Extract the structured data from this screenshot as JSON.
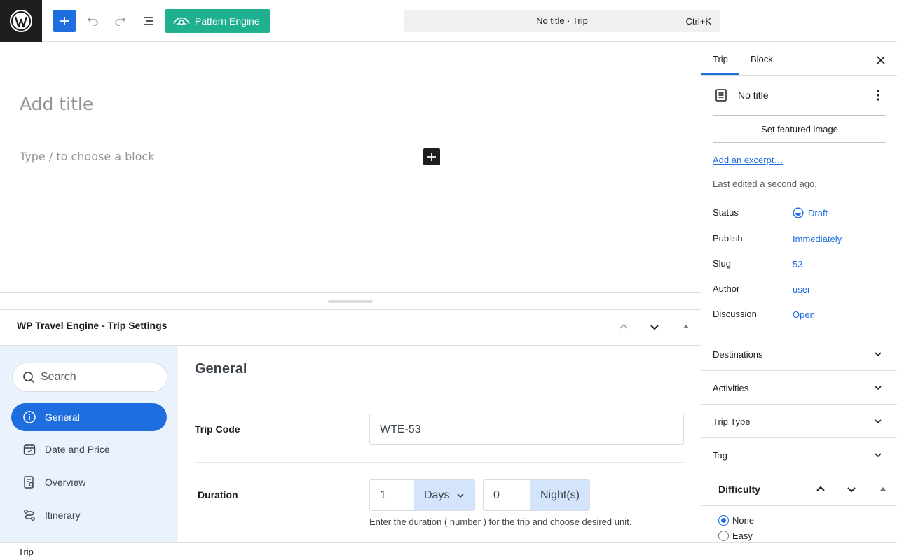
{
  "topbar": {
    "pattern_engine_label": "Pattern Engine",
    "command_title": "No title · Trip",
    "command_shortcut": "Ctrl+K"
  },
  "editor": {
    "title_placeholder": "Add title",
    "block_placeholder": "Type / to choose a block"
  },
  "meta_box": {
    "title": "WP Travel Engine - Trip Settings",
    "search_placeholder": "Search",
    "nav_items": [
      {
        "label": "General",
        "icon": "info-icon"
      },
      {
        "label": "Date and Price",
        "icon": "calendar-icon"
      },
      {
        "label": "Overview",
        "icon": "overview-icon"
      },
      {
        "label": "Itinerary",
        "icon": "route-icon"
      }
    ],
    "section_title": "General",
    "trip_code_label": "Trip Code",
    "trip_code_value": "WTE-53",
    "duration_label": "Duration",
    "duration_days_value": "1",
    "duration_days_unit": "Days",
    "duration_nights_value": "0",
    "duration_nights_unit": "Night(s)",
    "duration_help": "Enter the duration ( number ) for the trip and choose desired unit."
  },
  "sidebar": {
    "tabs": [
      "Trip",
      "Block"
    ],
    "post_title": "No title",
    "featured_image_label": "Set featured image",
    "excerpt_link": "Add an excerpt…",
    "last_edited": "Last edited a second ago.",
    "summary": [
      {
        "label": "Status",
        "value": "Draft"
      },
      {
        "label": "Publish",
        "value": "Immediately"
      },
      {
        "label": "Slug",
        "value": "53"
      },
      {
        "label": "Author",
        "value": "user"
      },
      {
        "label": "Discussion",
        "value": "Open"
      }
    ],
    "panels": [
      "Destinations",
      "Activities",
      "Trip Type",
      "Tag"
    ],
    "difficulty": {
      "title": "Difficulty",
      "options": [
        "None",
        "Easy"
      ],
      "selected": "None"
    }
  },
  "footer": {
    "breadcrumb": "Trip"
  },
  "colors": {
    "accent": "#1e6ee0",
    "pattern_engine": "#1fb08f",
    "nav_bg": "#eaf2fd"
  }
}
